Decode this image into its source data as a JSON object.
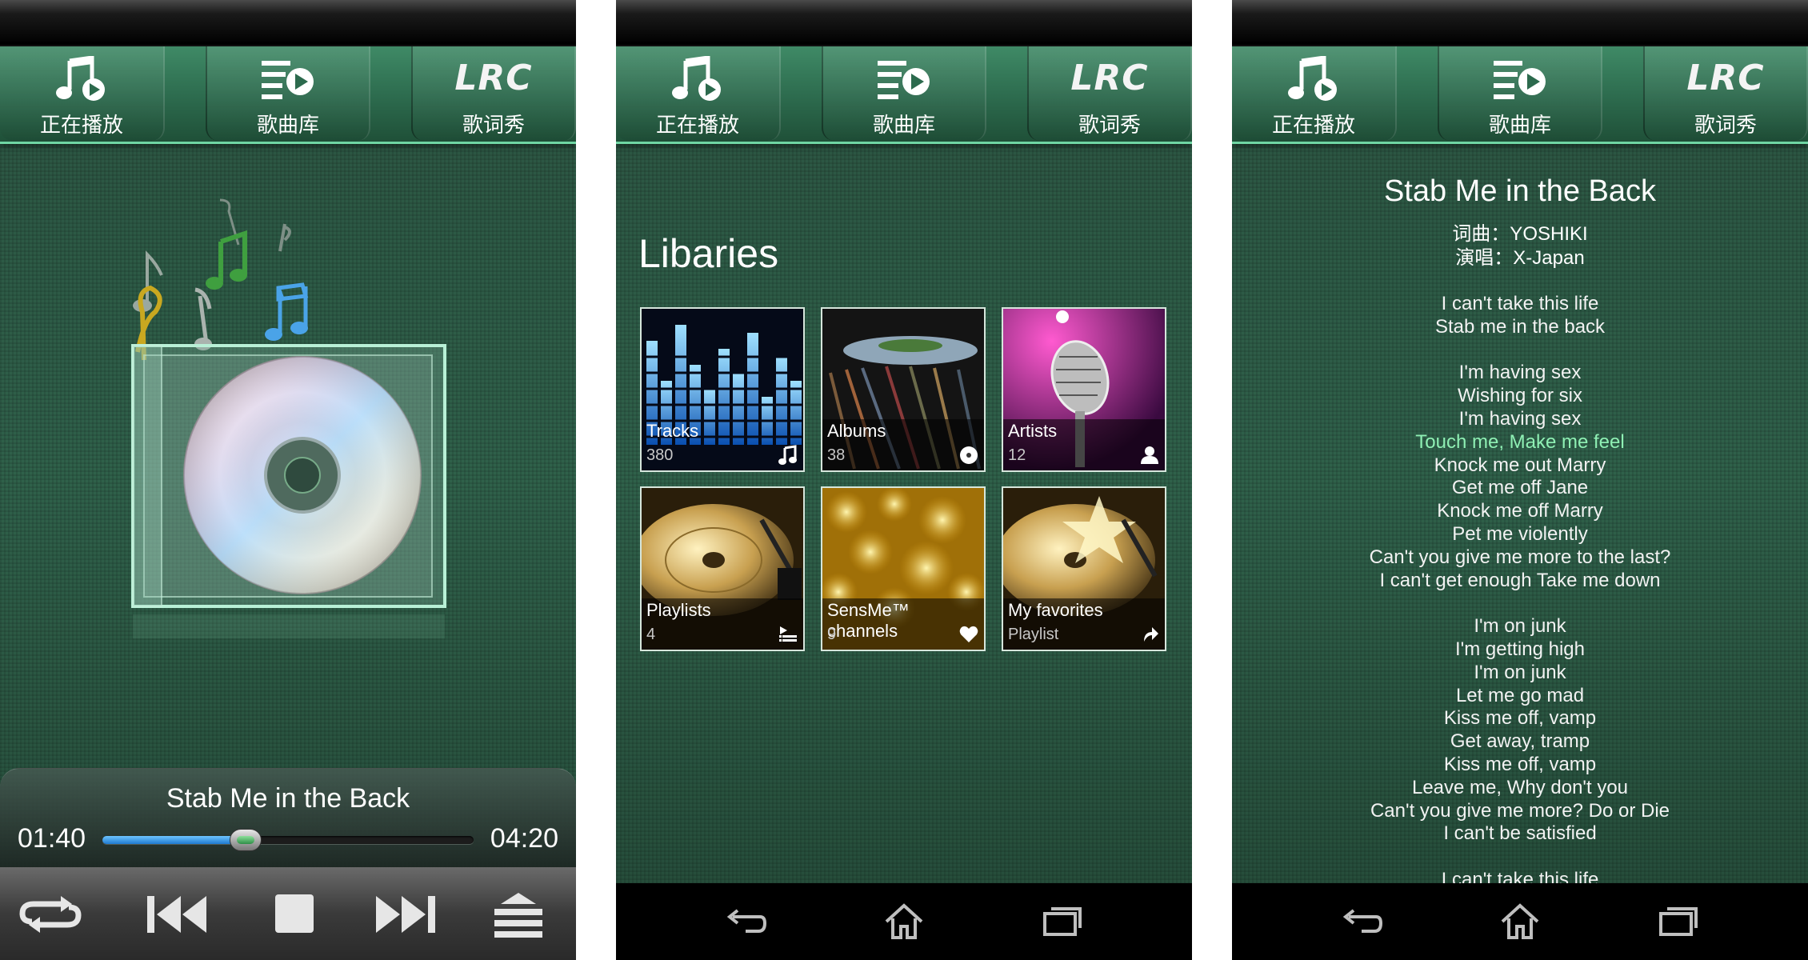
{
  "tabs": [
    {
      "label": "正在播放",
      "icon": "music-note-play-icon"
    },
    {
      "label": "歌曲库",
      "icon": "playlist-play-icon"
    },
    {
      "label": "歌词秀",
      "icon": "lrc-icon",
      "icon_text": "LRC"
    }
  ],
  "now_playing": {
    "title": "Stab Me in the Back",
    "elapsed": "01:40",
    "total": "04:20",
    "progress": 0.385
  },
  "controls": [
    "repeat-icon",
    "previous-icon",
    "stop-icon",
    "next-icon",
    "menu-icon"
  ],
  "library": {
    "heading": "Libaries",
    "tiles": [
      {
        "label": "Tracks",
        "sub": "380",
        "icon": "music-note-icon"
      },
      {
        "label": "Albums",
        "sub": "38",
        "icon": "disc-icon"
      },
      {
        "label": "Artists",
        "sub": "12",
        "icon": "person-icon"
      },
      {
        "label": "Playlists",
        "sub": "4",
        "icon": "list-icon"
      },
      {
        "label": "SensMe™ channels",
        "sub": "9",
        "icon": "heart-icon"
      },
      {
        "label": "My favorites",
        "sub": "Playlist",
        "icon": "arrow-icon"
      }
    ]
  },
  "navbar": [
    "back-icon",
    "home-icon",
    "recent-apps-icon"
  ],
  "lyrics": {
    "title": "Stab Me in the Back",
    "lyricist": "词曲：YOSHIKI",
    "singer": "演唱：X-Japan",
    "lines": [
      "I can't take this life",
      "Stab me in the back",
      "",
      "I'm having sex",
      "Wishing for six",
      "I'm having sex",
      "Touch me, Make me feel",
      "Knock me out Marry",
      "Get me off Jane",
      "Knock me off Marry",
      "Pet me violently",
      "Can't you give me more to the last?",
      "I can't get enough Take me down",
      "",
      "I'm on junk",
      "I'm getting high",
      "I'm on junk",
      "Let me go mad",
      "Kiss me off, vamp",
      "Get away, tramp",
      "Kiss me off, vamp",
      "Leave me, Why don't you",
      "Can't you give me more? Do or Die",
      "I can't be satisfied",
      "",
      "I can't take this life"
    ],
    "highlight_index": 6
  }
}
